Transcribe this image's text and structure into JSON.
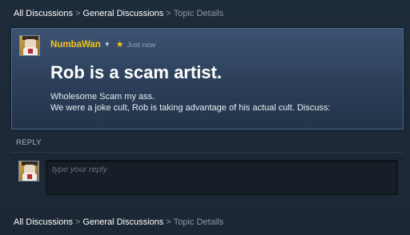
{
  "breadcrumb": {
    "items": [
      "All Discussions",
      "General Discussions"
    ],
    "separator": ">",
    "current": "Topic Details"
  },
  "post": {
    "author": "NumbaWan",
    "author_menu_icon": "caret-down-icon",
    "badge_icon": "star-icon",
    "timestamp": "Just now",
    "title": "Rob is a scam artist.",
    "body_lines": [
      "Wholesome Scam my ass.",
      "We were a joke cult, Rob is taking advantage of his actual cult. Discuss:"
    ]
  },
  "reply": {
    "label": "REPLY",
    "placeholder": "type your reply"
  },
  "colors": {
    "background": "#1b2838",
    "author": "#f5c518",
    "card": "#3b5272"
  }
}
